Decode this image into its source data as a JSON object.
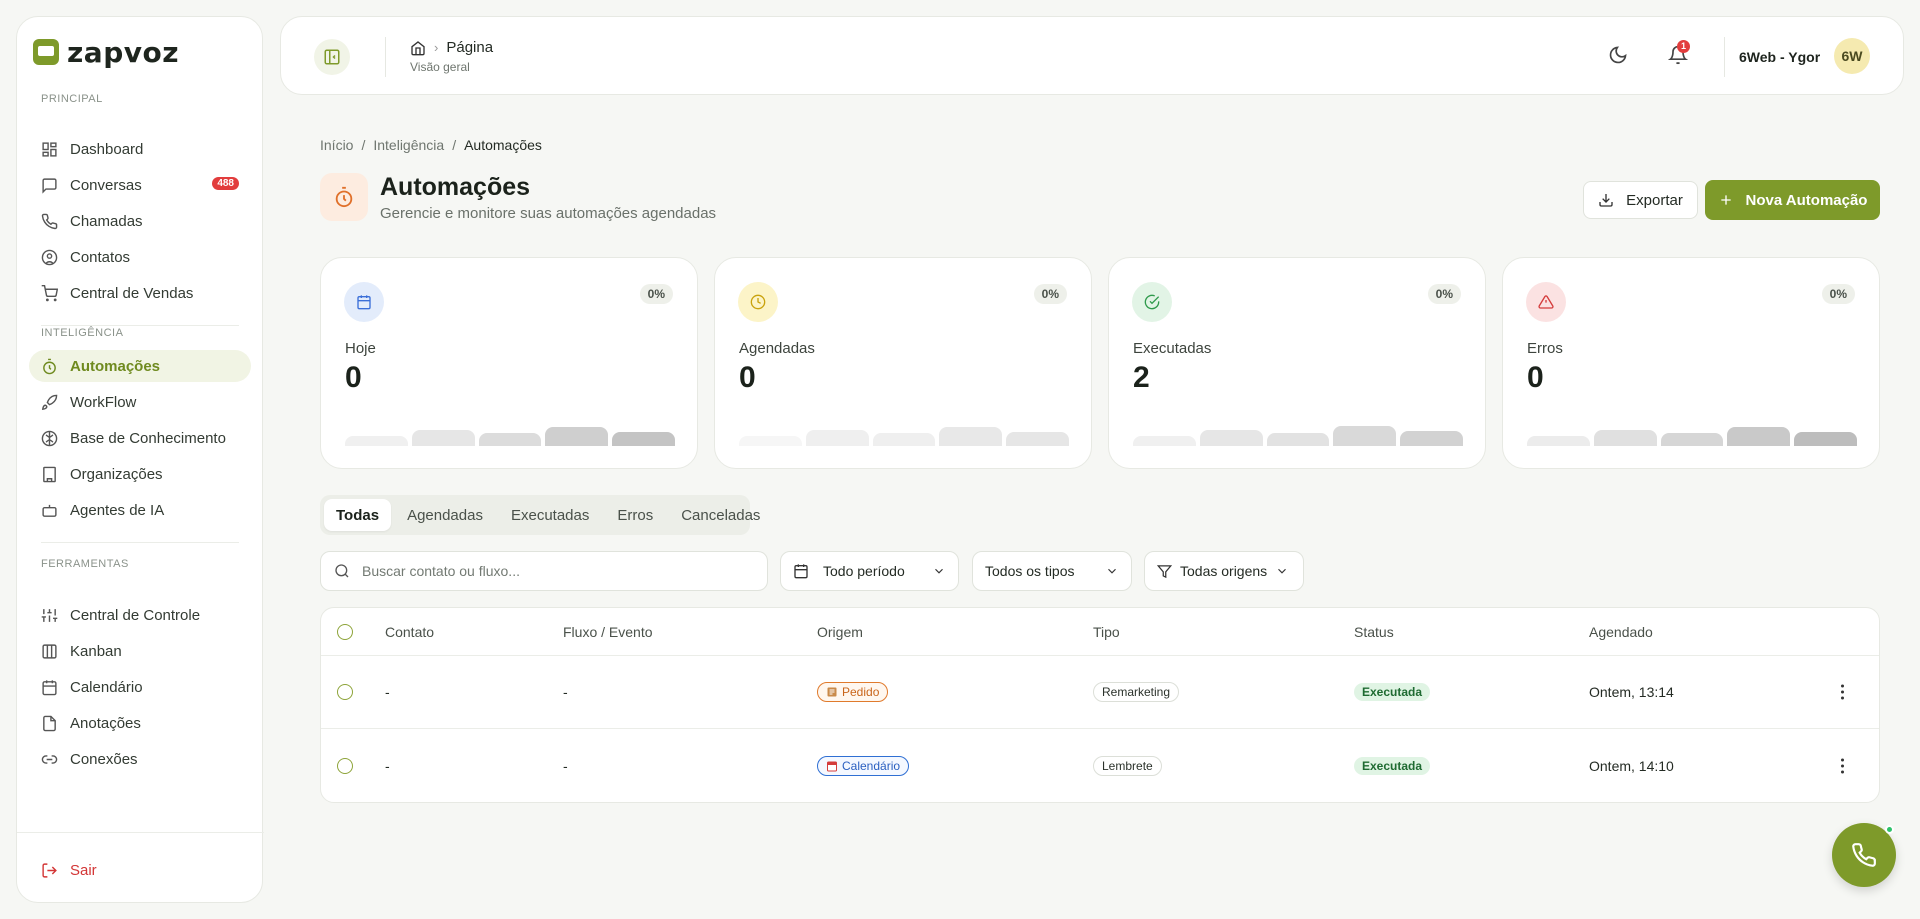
{
  "app": {
    "logo_text": "zapvoz"
  },
  "sidebar": {
    "sections": [
      {
        "title": "PRINCIPAL",
        "items": [
          {
            "label": "Dashboard",
            "icon": "dashboard-icon"
          },
          {
            "label": "Conversas",
            "icon": "chat-icon",
            "badge": "488"
          },
          {
            "label": "Chamadas",
            "icon": "phone-icon"
          },
          {
            "label": "Contatos",
            "icon": "contact-icon"
          },
          {
            "label": "Central de Vendas",
            "icon": "cart-icon"
          }
        ]
      },
      {
        "title": "INTELIGÊNCIA",
        "items": [
          {
            "label": "Automações",
            "icon": "timer-icon",
            "active": true
          },
          {
            "label": "WorkFlow",
            "icon": "rocket-icon"
          },
          {
            "label": "Base de Conhecimento",
            "icon": "brain-icon"
          },
          {
            "label": "Organizações",
            "icon": "building-icon"
          },
          {
            "label": "Agentes de IA",
            "icon": "bot-icon"
          }
        ]
      },
      {
        "title": "FERRAMENTAS",
        "items": [
          {
            "label": "Central de Controle",
            "icon": "sliders-icon"
          },
          {
            "label": "Kanban",
            "icon": "kanban-icon"
          },
          {
            "label": "Calendário",
            "icon": "calendar-icon"
          },
          {
            "label": "Anotações",
            "icon": "file-icon"
          },
          {
            "label": "Conexões",
            "icon": "link-icon"
          }
        ]
      }
    ],
    "logout_label": "Sair"
  },
  "header": {
    "crumb": "Página",
    "sub": "Visão geral",
    "notification_count": "1",
    "user_name": "6Web - Ygor",
    "avatar_initials": "6W"
  },
  "page": {
    "breadcrumb": [
      "Início",
      "Inteligência",
      "Automações"
    ],
    "title": "Automações",
    "subtitle": "Gerencie e monitore suas automações agendadas",
    "export_label": "Exportar",
    "new_label": "Nova Automação"
  },
  "stats": [
    {
      "label": "Hoje",
      "value": "0",
      "pct": "0%",
      "icon": "calendar-icon",
      "color": "#3b6fd8",
      "bg": "#e3ecfb"
    },
    {
      "label": "Agendadas",
      "value": "0",
      "pct": "0%",
      "icon": "clock-icon",
      "color": "#c9a20c",
      "bg": "#fcf4c8"
    },
    {
      "label": "Executadas",
      "value": "2",
      "pct": "0%",
      "icon": "check-circle-icon",
      "color": "#2f9a4c",
      "bg": "#e2f4e6"
    },
    {
      "label": "Erros",
      "value": "0",
      "pct": "0%",
      "icon": "alert-icon",
      "color": "#d43c3c",
      "bg": "#fbe2e2"
    }
  ],
  "tabs": [
    "Todas",
    "Agendadas",
    "Executadas",
    "Erros",
    "Canceladas"
  ],
  "filters": {
    "search_placeholder": "Buscar contato ou fluxo...",
    "period": "Todo período",
    "types": "Todos os tipos",
    "origins": "Todas origens"
  },
  "table": {
    "columns": [
      "Contato",
      "Fluxo / Evento",
      "Origem",
      "Tipo",
      "Status",
      "Agendado"
    ],
    "rows": [
      {
        "contato": "-",
        "fluxo": "-",
        "origem": "Pedido",
        "tipo": "Remarketing",
        "status": "Executada",
        "agendado": "Ontem, 13:14"
      },
      {
        "contato": "-",
        "fluxo": "-",
        "origem": "Calendário",
        "tipo": "Lembrete",
        "status": "Executada",
        "agendado": "Ontem, 14:10"
      }
    ]
  },
  "colors": {
    "accent": "#7e9a2a",
    "danger": "#e23d3d"
  }
}
